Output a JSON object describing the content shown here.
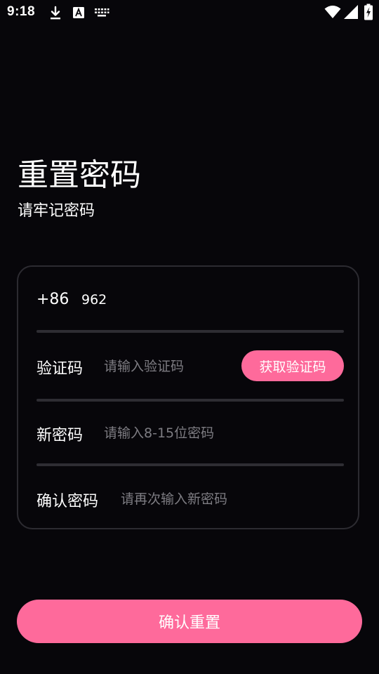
{
  "status_bar": {
    "time": "9:18",
    "icons": [
      "download-icon",
      "font-a-icon",
      "keyboard-icon",
      "wifi-icon",
      "cellular-signal-icon",
      "battery-charging-icon"
    ]
  },
  "header": {
    "title": "重置密码",
    "subtitle": "请牢记密码"
  },
  "form": {
    "phone": {
      "country_code": "+86",
      "value": "962"
    },
    "verification": {
      "label": "验证码",
      "placeholder": "请输入验证码",
      "button_label": "获取验证码"
    },
    "new_password": {
      "label": "新密码",
      "placeholder": "请输入8-15位密码"
    },
    "confirm_password": {
      "label": "确认密码",
      "placeholder": "请再次输入新密码"
    }
  },
  "actions": {
    "confirm_label": "确认重置"
  },
  "colors": {
    "background": "#07060a",
    "accent": "#fe6a9b",
    "divider": "#2e2d33",
    "card_border": "#2c2b31",
    "placeholder": "#7d7c82"
  }
}
